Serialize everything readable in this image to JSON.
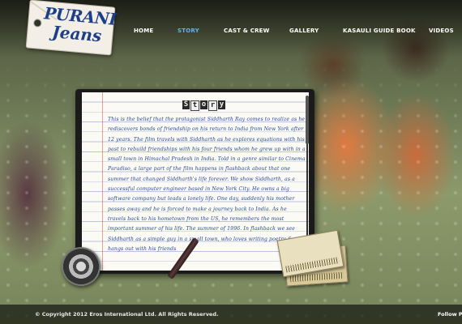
{
  "logo": {
    "title_line1": "PURANI",
    "title_line2": "Jeans"
  },
  "nav": {
    "items": [
      {
        "label": "HOME",
        "active": false
      },
      {
        "label": "STORY",
        "active": true
      },
      {
        "label": "CAST & CREW",
        "active": false
      },
      {
        "label": "GALLERY",
        "active": false
      },
      {
        "label": "KASAULI GUIDE BOOK",
        "active": false
      },
      {
        "label": "VIDEOS",
        "active": false
      }
    ]
  },
  "story": {
    "heading_letters": [
      "S",
      "t",
      "o",
      "r",
      "y"
    ],
    "text": "This is the belief that the protagonist Siddharth Ray comes to realize as he rediscovers bonds of friendship on his return to India from New York after 12 years. The film travels with Siddharth as he explores equations with his past to rebuild friendships with his four friends whom he grew up with in a small town in Himachal Pradesh in India. Told in a genre similar to Cinema Paradiso, a large part of the film happens in flashback about that one summer that changed Siddharth's life forever. We show Siddharth, as a successful computer engineer based in New York City. He owns a big software company but leads a lonely life. One day, suddenly his mother passes away and he is forced to make a journey back to India. As he travels back to his hometown from the US, he remembers the most important summer of his life. The summer of 1996. In flashback we see Siddharth as a simple guy in a small town, who loves writing poetry & hangs out with his friends"
  },
  "footer": {
    "copyright": "© Copyright 2012 Eros International Ltd. All Rights Reserved.",
    "follow": "Follow P"
  },
  "colors": {
    "nav_active": "#57b3ff",
    "story_ink": "#24469c"
  }
}
